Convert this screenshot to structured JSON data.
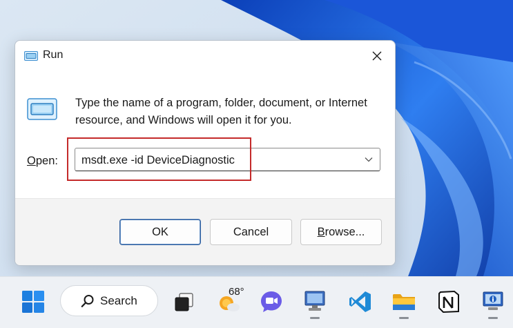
{
  "dialog": {
    "title": "Run",
    "description": "Type the name of a program, folder, document, or Internet resource, and Windows will open it for you.",
    "open_label_prefix": "",
    "open_label_accel": "O",
    "open_label_rest": "pen:",
    "open_value": "msdt.exe -id DeviceDiagnostic",
    "buttons": {
      "ok": "OK",
      "cancel": "Cancel",
      "browse_accel": "B",
      "browse_rest": "rowse..."
    }
  },
  "taskbar": {
    "search_label": "Search",
    "weather_temp": "68°",
    "apps": [
      "start-icon",
      "search",
      "task-view-icon",
      "weather-icon",
      "teams-chat-icon",
      "remote-desktop-icon",
      "vscode-icon",
      "file-explorer-icon",
      "notion-icon",
      "system-info-icon"
    ]
  },
  "colors": {
    "highlight": "#c42a2a",
    "accent": "#2f5f9e",
    "taskbar": "#eef1f5",
    "wallpaper_blue": "#1f5fd0"
  }
}
